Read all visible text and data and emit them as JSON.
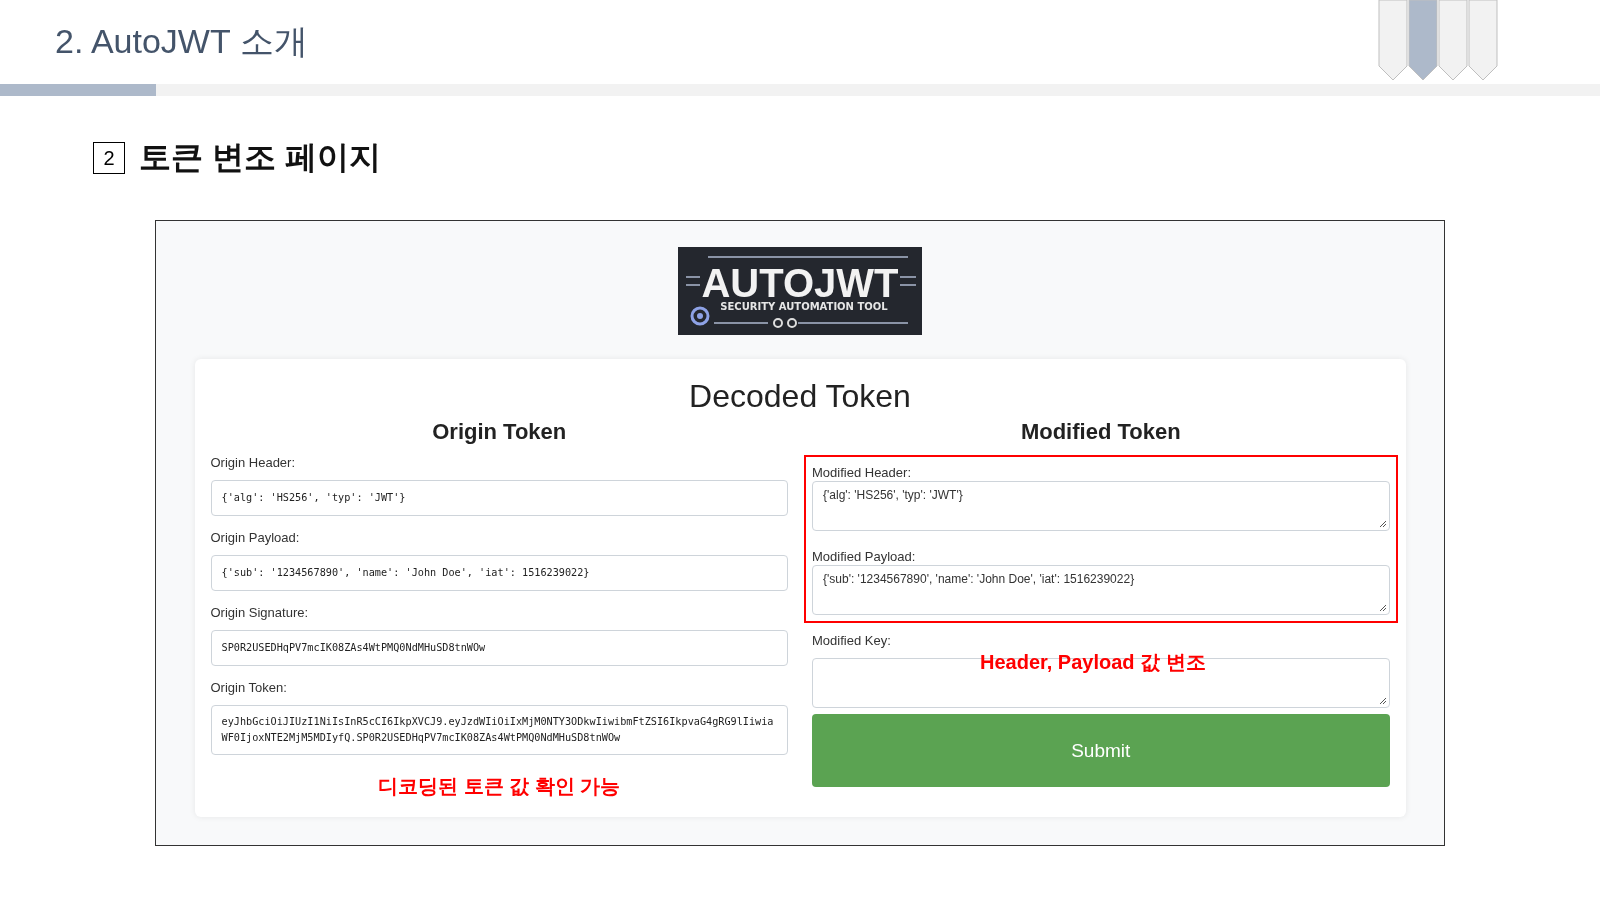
{
  "slide": {
    "title": "2. AutoJWT 소개",
    "section_number": "2",
    "section_title": "토큰 변조 페이지"
  },
  "app": {
    "logo": {
      "title": "AUTOJWT",
      "subtitle": "SECURITY AUTOMATION TOOL"
    },
    "heading": "Decoded Token",
    "origin": {
      "title": "Origin Token",
      "fields": [
        {
          "label": "Origin Header:",
          "value": "{'alg': 'HS256', 'typ': 'JWT'}",
          "kind": "code"
        },
        {
          "label": "Origin Payload:",
          "value": "{'sub': '1234567890', 'name': 'John Doe', 'iat': 1516239022}",
          "kind": "code"
        },
        {
          "label": "Origin Signature:",
          "value": "SP0R2USEDHqPV7mcIK08ZAs4WtPMQ0NdMHuSD8tnWOw",
          "kind": "code"
        },
        {
          "label": "Origin Token:",
          "value": "eyJhbGciOiJIUzI1NiIsInR5cCI6IkpXVCJ9.eyJzdWIiOiIxMjM0NTY3ODkwIiwibmFtZSI6IkpvaG4gRG9lIiwiaWF0IjoxNTE2MjM5MDIyfQ.SP0R2USEDHqPV7mcIK08ZAs4WtPMQ0NdMHuSD8tnWOw",
          "kind": "code"
        }
      ],
      "note": "디코딩된 토큰 값 확인 가능"
    },
    "modified": {
      "title": "Modified Token",
      "fields": [
        {
          "label": "Modified Header:",
          "value": "{'alg': 'HS256', 'typ': 'JWT'}",
          "kind": "textarea",
          "highlighted": true
        },
        {
          "label": "Modified Payload:",
          "value": "{'sub': '1234567890', 'name': 'John Doe', 'iat': 1516239022}",
          "kind": "textarea",
          "highlighted": true
        },
        {
          "label": "Modified Key:",
          "kind": "textarea",
          "highlighted": false
        }
      ],
      "note": "Header, Payload 값 변조",
      "submit": "Submit"
    }
  }
}
